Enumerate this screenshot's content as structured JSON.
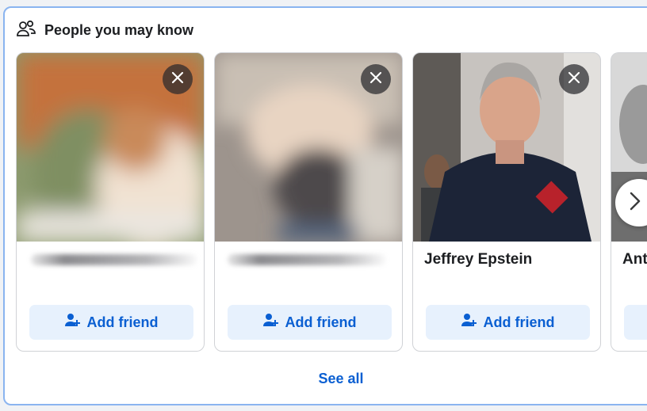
{
  "section": {
    "title": "People you may know",
    "icon": "people-icon",
    "see_all_label": "See all"
  },
  "cards": [
    {
      "name": "",
      "name_obscured": true,
      "photo_obscured": true,
      "add_label": "Add friend",
      "dismiss_icon": "close-icon",
      "add_icon": "add-person-icon"
    },
    {
      "name": "",
      "name_obscured": true,
      "photo_obscured": true,
      "add_label": "Add friend",
      "dismiss_icon": "close-icon",
      "add_icon": "add-person-icon"
    },
    {
      "name": "Jeffrey Epstein",
      "name_obscured": false,
      "photo_obscured": false,
      "add_label": "Add friend",
      "dismiss_icon": "close-icon",
      "add_icon": "add-person-icon"
    },
    {
      "name": "Ant",
      "name_obscured": false,
      "photo_obscured": false,
      "add_label": "",
      "dismiss_icon": "close-icon",
      "add_icon": "add-person-icon"
    }
  ],
  "carousel": {
    "next_icon": "chevron-right-icon"
  },
  "colors": {
    "accent": "#0a5fd2",
    "button_bg": "#e7f1fd",
    "panel_border": "#8ab4f0"
  }
}
